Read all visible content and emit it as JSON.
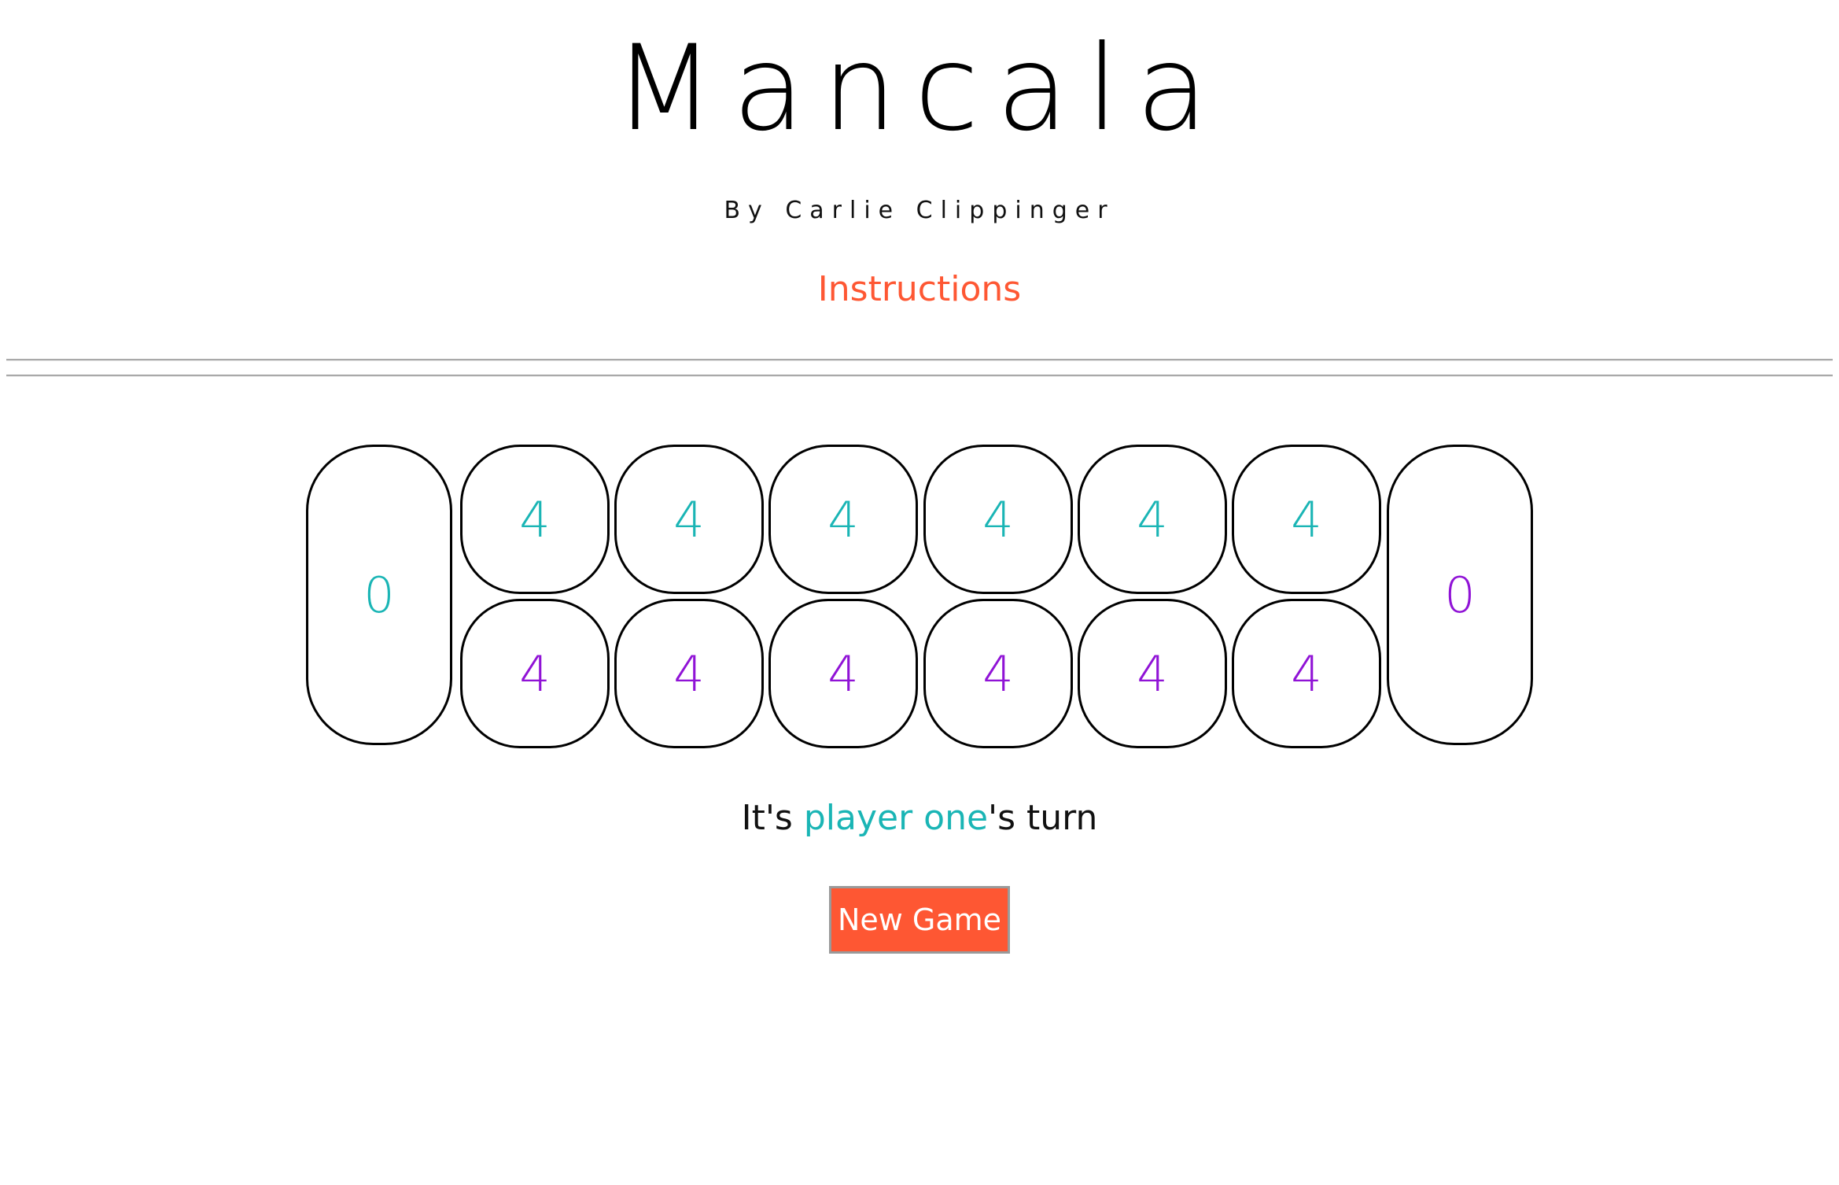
{
  "header": {
    "title": "Mancala",
    "byline": "By Carlie Clippinger",
    "instructions_link": "Instructions"
  },
  "colors": {
    "player_one": "#1ab5b5",
    "player_two": "#9013d6",
    "accent": "#fe5733"
  },
  "board": {
    "player_one_store": "0",
    "player_two_store": "0",
    "player_one_pits": [
      "4",
      "4",
      "4",
      "4",
      "4",
      "4"
    ],
    "player_two_pits": [
      "4",
      "4",
      "4",
      "4",
      "4",
      "4"
    ]
  },
  "status": {
    "prefix": "It's ",
    "player": "player one",
    "suffix": "'s turn"
  },
  "controls": {
    "new_game_label": "New Game"
  }
}
